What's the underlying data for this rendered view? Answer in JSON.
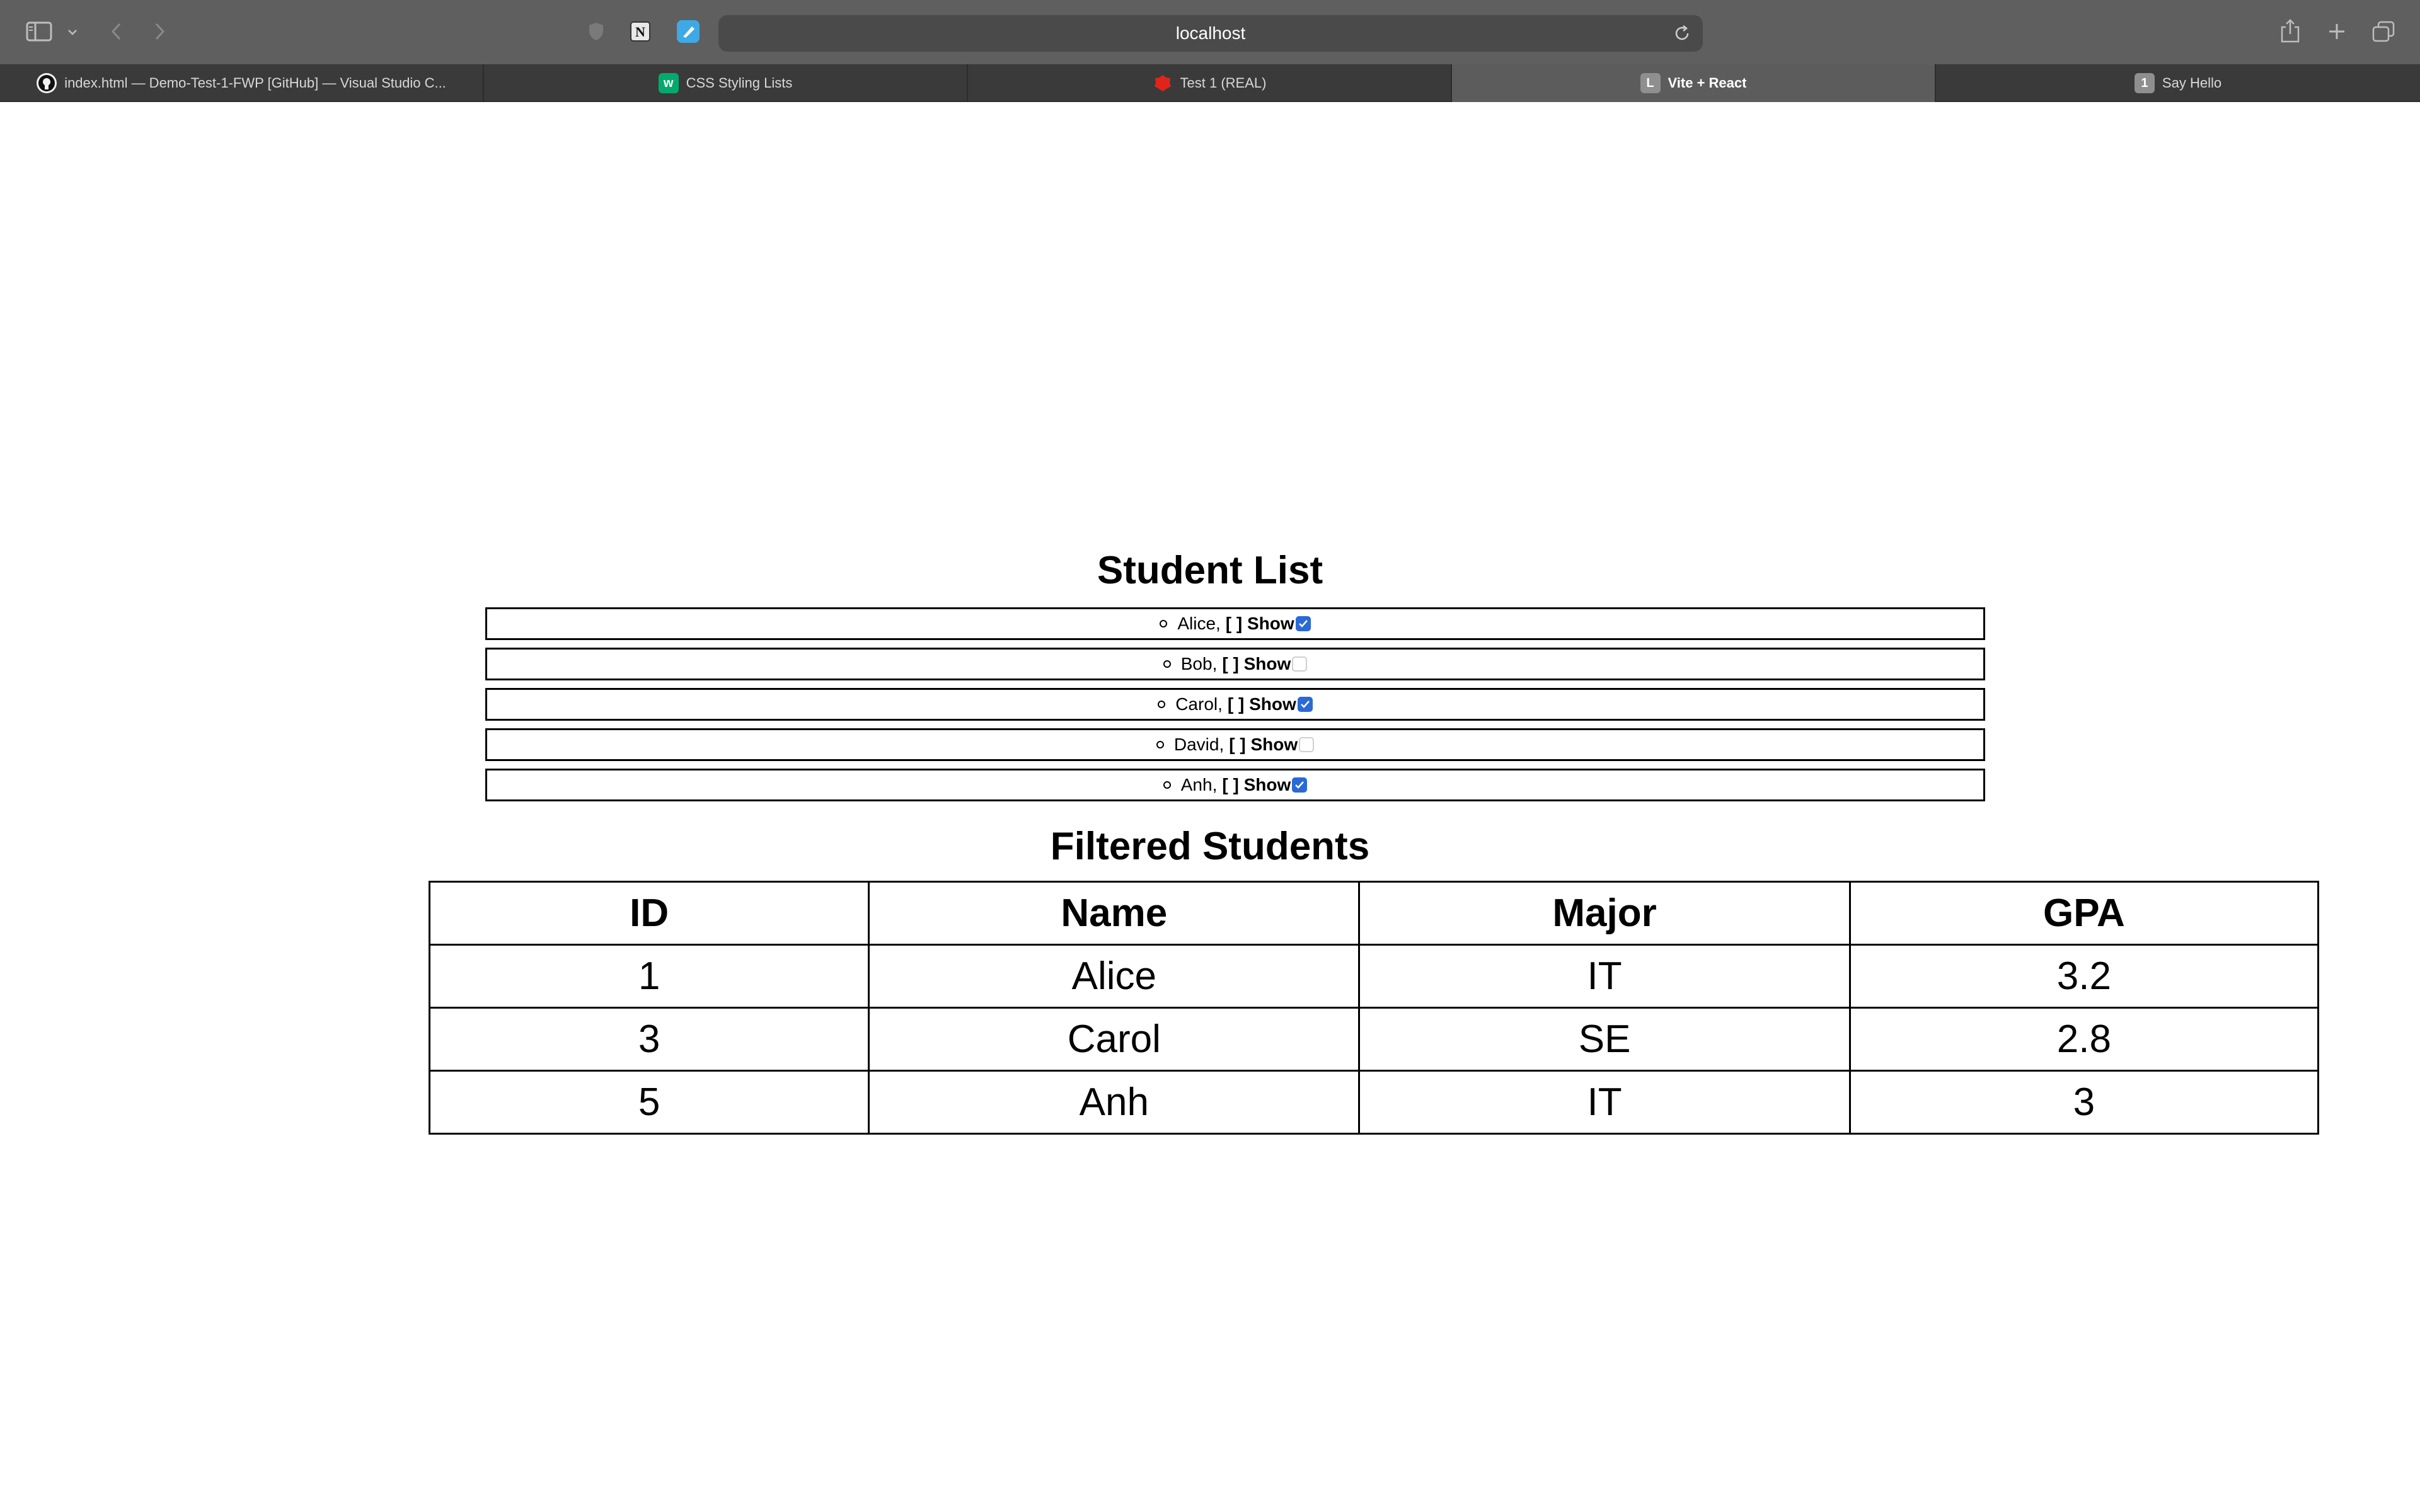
{
  "browser": {
    "url": "localhost",
    "tabs": [
      {
        "label": "index.html — Demo-Test-1-FWP [GitHub] — Visual Studio C...",
        "favicon": "github-icon",
        "active": false
      },
      {
        "label": "CSS Styling Lists",
        "favicon": "w3schools-icon",
        "favicon_text": "w",
        "active": false
      },
      {
        "label": "Test 1 (REAL)",
        "favicon": "red-blob-icon",
        "active": false
      },
      {
        "label": "Vite + React",
        "favicon": "letter-l-icon",
        "favicon_text": "L",
        "active": true
      },
      {
        "label": "Say Hello",
        "favicon": "number-1-icon",
        "favicon_text": "1",
        "active": false
      }
    ],
    "icons": {
      "sidebar": "sidebar-icon",
      "back": "back-icon",
      "forward": "forward-icon",
      "shield": "shield-icon",
      "notion": "notion-icon",
      "extension": "pen-extension-icon",
      "reload": "reload-icon",
      "share": "share-icon",
      "new_tab": "plus-icon",
      "tab_overview": "tab-overview-icon"
    },
    "colors": {
      "toolbar": "#5f5f5f",
      "tabbar": "#3a3a3a",
      "active_tab": "#5c5c5c",
      "checkbox": "#2a6ad6"
    }
  },
  "page": {
    "student_list_title": "Student List",
    "students": [
      {
        "name": "Alice,",
        "tag": "[ ] Show",
        "checked": true
      },
      {
        "name": "Bob,",
        "tag": "[ ] Show",
        "checked": false
      },
      {
        "name": "Carol,",
        "tag": "[ ] Show",
        "checked": true
      },
      {
        "name": "David,",
        "tag": "[ ] Show",
        "checked": false
      },
      {
        "name": "Anh,",
        "tag": "[ ] Show",
        "checked": true
      }
    ],
    "filtered_title": "Filtered Students",
    "table": {
      "headers": [
        "ID",
        "Name",
        "Major",
        "GPA"
      ],
      "rows": [
        [
          "1",
          "Alice",
          "IT",
          "3.2"
        ],
        [
          "3",
          "Carol",
          "SE",
          "2.8"
        ],
        [
          "5",
          "Anh",
          "IT",
          "3"
        ]
      ]
    }
  }
}
